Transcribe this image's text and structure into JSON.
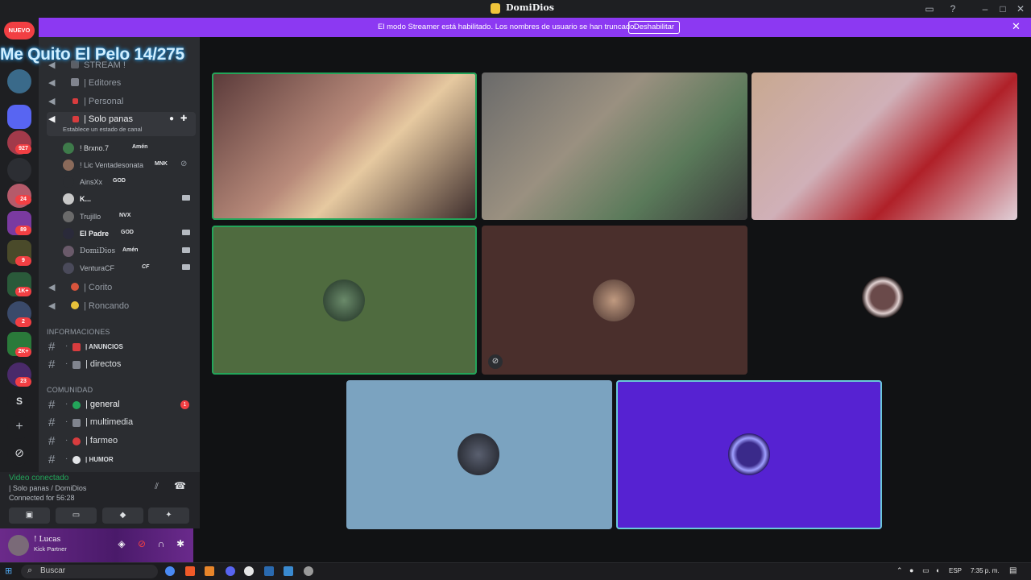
{
  "window": {
    "title": "DomiDios"
  },
  "banner": {
    "message": "El modo Streamer está habilitado. Los nombres de usuario se han truncado.",
    "disable_label": "Deshabilitar"
  },
  "overlay": {
    "text": "Me Quito El Pelo 14/275"
  },
  "rail": {
    "new_label": "NUEVO",
    "badges": [
      "927",
      "24",
      "89",
      "9",
      "1K+",
      "2",
      "2K+",
      "23"
    ],
    "letter_server": "S"
  },
  "channels": {
    "voice": [
      {
        "label": "STREAM !"
      },
      {
        "label": "| Editores"
      },
      {
        "label": "| Personal"
      },
      {
        "label": "| Solo panas",
        "status_hint": "Establece un estado de canal"
      },
      {
        "label": "| Corito"
      },
      {
        "label": "| Roncando"
      }
    ],
    "members": [
      {
        "name": "! Brxno.7",
        "tag": "Amén"
      },
      {
        "name": "! Lic Ventadesonata",
        "tag": "MNK"
      },
      {
        "name": "AinsXx",
        "tag": "GOD"
      },
      {
        "name": "K...",
        "tag": ""
      },
      {
        "name": "Trujillo",
        "tag": "NVX"
      },
      {
        "name": "El Padre",
        "tag": "GOD"
      },
      {
        "name": "DomiDios",
        "tag": "Amén"
      },
      {
        "name": "VenturaCF",
        "tag": "CF"
      }
    ],
    "categories": {
      "info": "INFORMACIONES",
      "community": "COMUNIDAD"
    },
    "text_info": [
      {
        "label": "| ANUNCIOS"
      },
      {
        "label": "| directos"
      }
    ],
    "text_community": [
      {
        "label": "| general",
        "unread": "1"
      },
      {
        "label": "| multimedia"
      },
      {
        "label": "| farmeo"
      },
      {
        "label": "| HUMOR"
      }
    ]
  },
  "voice_panel": {
    "status": "Video conectado",
    "channel": "| Solo panas / DomiDios",
    "time": "Connected for 56:28"
  },
  "user_panel": {
    "name": "! Lucas",
    "status": "Kick Partner"
  },
  "taskbar": {
    "search_placeholder": "Buscar",
    "lang": "ESP",
    "clock": "7:35 p. m."
  },
  "colors": {
    "accent": "#8c39f2",
    "speaking": "#23a55a",
    "tile_green": "#4f6b3f",
    "tile_brown": "#4a2f2c",
    "tile_blue": "#7ba3c0",
    "tile_purple": "#5622d2"
  }
}
